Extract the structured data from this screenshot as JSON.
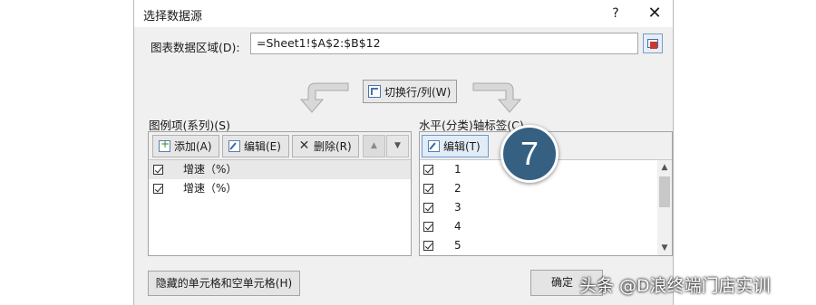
{
  "dialog": {
    "title": "选择数据源",
    "help": "?",
    "close": "✕"
  },
  "range": {
    "label": "图表数据区域(D):",
    "value": "=Sheet1!$A$2:$B$12"
  },
  "switch_button": "切换行/列(W)",
  "series_panel": {
    "title": "图例项(系列)(S)",
    "add_label": "添加(A)",
    "edit_label": "编辑(E)",
    "delete_label": "删除(R)",
    "up_label": "▲",
    "down_label": "▼",
    "items": [
      {
        "label": "增速（%）",
        "checked": true,
        "selected": true
      },
      {
        "label": "增速（%）",
        "checked": true,
        "selected": false
      }
    ]
  },
  "axis_panel": {
    "title": "水平(分类)轴标签(C)",
    "edit_label": "编辑(T)",
    "items": [
      {
        "label": "1",
        "checked": true
      },
      {
        "label": "2",
        "checked": true
      },
      {
        "label": "3",
        "checked": true
      },
      {
        "label": "4",
        "checked": true
      },
      {
        "label": "5",
        "checked": true
      }
    ],
    "scroll_up": "▲",
    "scroll_down": "▼"
  },
  "badge": "7",
  "footer": {
    "hidden_cells_label": "隐藏的单元格和空单元格(H)",
    "ok_label": "确定"
  },
  "watermark": "头条 @D浪终端门店实训",
  "colors": {
    "badge": "#356082",
    "dialog_bg": "#f0f0f0",
    "active_button": "#e1ecf7"
  }
}
